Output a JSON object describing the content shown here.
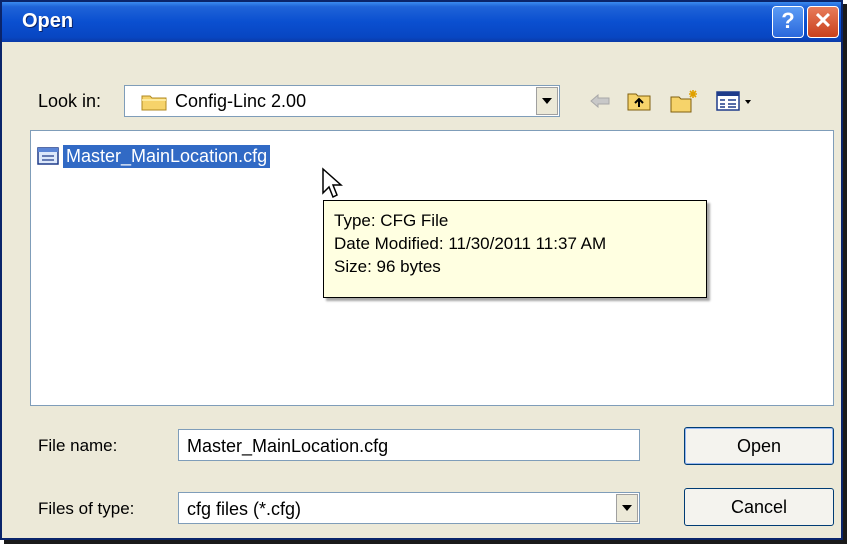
{
  "window": {
    "title": "Open",
    "help_glyph": "?",
    "close_glyph": "✕"
  },
  "look_in": {
    "label": "Look in:",
    "value": "Config-Linc 2.00",
    "icon": "folder-icon"
  },
  "toolbar": {
    "icons": [
      "back-arrow-icon",
      "up-folder-icon",
      "new-folder-icon",
      "view-menu-icon"
    ]
  },
  "file_list": {
    "items": [
      {
        "name": "Master_MainLocation.cfg",
        "icon": "cfg-file-icon",
        "selected": true
      }
    ]
  },
  "tooltip": {
    "type_line": "Type: CFG File",
    "date_line": "Date Modified: 11/30/2011 11:37 AM",
    "size_line": "Size: 96 bytes"
  },
  "file_name": {
    "label": "File name:",
    "value": "Master_MainLocation.cfg"
  },
  "files_of_type": {
    "label": "Files of type:",
    "value": "cfg files (*.cfg)"
  },
  "buttons": {
    "open": "Open",
    "cancel": "Cancel"
  },
  "colors": {
    "titlebar": "#0a4fd0",
    "selection": "#316ac5",
    "tooltip_bg": "#ffffe1",
    "dialog_bg": "#ece9d8"
  }
}
